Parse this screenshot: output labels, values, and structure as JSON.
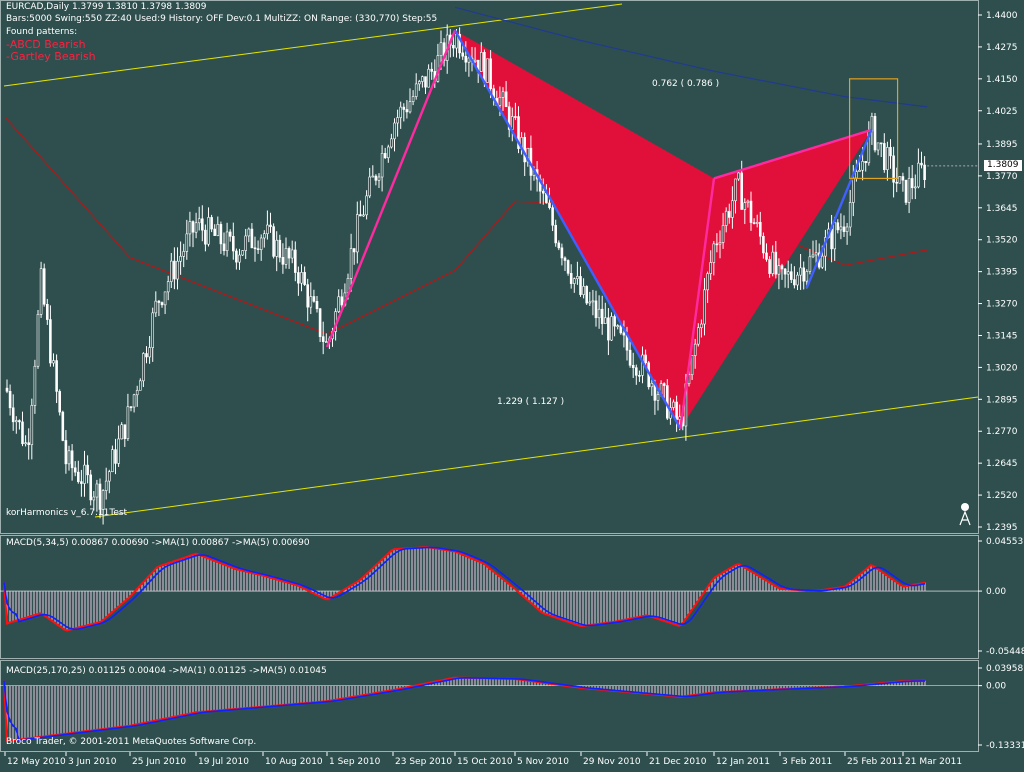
{
  "header": {
    "symbol_line": "EURCAD,Daily  1.3799 1.3810 1.3798 1.3809",
    "params_line": "Bars:5000  Swing:550  ZZ:40  Used:9  History: OFF Dev:0.1  MultiZZ: ON  Range: (330,770)  Step:55",
    "found_label": "Found patterns:",
    "patterns": [
      "-ABCD Bearish",
      "-Gartley Bearish"
    ]
  },
  "annotations": {
    "ratio_upper": "0.762 ( 0.786 )",
    "ratio_lower": "1.229 ( 1.127 )",
    "indicator_name": "korHarmonics  v_6.7.11Test",
    "current_price": "1.3809",
    "copyright": "Broco Trader, © 2001-2011 MetaQuotes Software Corp."
  },
  "colors": {
    "background": "#2f4f4f",
    "candles": "#ffffff",
    "pattern_fill": "#e0103a",
    "leg_pink": "#ff2aa0",
    "leg_blue": "#4060ff",
    "channel": "#e6e600",
    "ma_red": "#b01818",
    "ma_blue": "#203a90",
    "box": "#e0a020",
    "histogram": "#e8c8e0",
    "macd_red": "#ff1010",
    "macd_blue": "#1020ff"
  },
  "chart_data": [
    {
      "type": "candlestick",
      "title": "EURCAD,Daily",
      "ylim": [
        1.2395,
        1.44
      ],
      "y_ticks": [
        "1.4400",
        "1.4275",
        "1.4150",
        "1.4025",
        "1.3895",
        "1.3770",
        "1.3645",
        "1.3520",
        "1.3395",
        "1.3270",
        "1.3145",
        "1.3020",
        "1.2895",
        "1.2770",
        "1.2645",
        "1.2520",
        "1.2395"
      ],
      "x_ticks": [
        "12 May 2010",
        "3 Jun 2010",
        "25 Jun 2010",
        "19 Jul 2010",
        "10 Aug 2010",
        "1 Sep 2010",
        "23 Sep 2010",
        "15 Oct 2010",
        "5 Nov 2010",
        "29 Nov 2010",
        "21 Dec 2010",
        "12 Jan 2011",
        "3 Feb 2011",
        "25 Feb 2011",
        "21 Mar 2011"
      ],
      "close_path": [
        [
          "12 May 2010",
          1.295
        ],
        [
          "20 May 2010",
          1.27
        ],
        [
          "25 May 2010",
          1.335
        ],
        [
          "3 Jun 2010",
          1.265
        ],
        [
          "15 Jun 2010",
          1.252
        ],
        [
          "25 Jun 2010",
          1.285
        ],
        [
          "5 Jul 2010",
          1.328
        ],
        [
          "19 Jul 2010",
          1.358
        ],
        [
          "1 Aug 2010",
          1.348
        ],
        [
          "10 Aug 2010",
          1.355
        ],
        [
          "22 Aug 2010",
          1.34
        ],
        [
          "1 Sep 2010",
          1.31
        ],
        [
          "12 Sep 2010",
          1.36
        ],
        [
          "23 Sep 2010",
          1.398
        ],
        [
          "5 Oct 2010",
          1.415
        ],
        [
          "15 Oct 2010",
          1.432
        ],
        [
          "25 Oct 2010",
          1.42
        ],
        [
          "5 Nov 2010",
          1.395
        ],
        [
          "15 Nov 2010",
          1.368
        ],
        [
          "29 Nov 2010",
          1.33
        ],
        [
          "10 Dec 2010",
          1.315
        ],
        [
          "21 Dec 2010",
          1.3
        ],
        [
          "1 Jan 2011",
          1.279
        ],
        [
          "12 Jan 2011",
          1.35
        ],
        [
          "20 Jan 2011",
          1.373
        ],
        [
          "3 Feb 2011",
          1.335
        ],
        [
          "15 Feb 2011",
          1.345
        ],
        [
          "25 Feb 2011",
          1.36
        ],
        [
          "8 Mar 2011",
          1.395
        ],
        [
          "21 Mar 2011",
          1.37
        ],
        [
          "31 Mar 2011",
          1.3809
        ]
      ],
      "pattern_points": {
        "X": [
          "1 Sep 2010",
          1.31
        ],
        "A": [
          "15 Oct 2010",
          1.434
        ],
        "B": [
          "12 Jan 2011",
          1.376
        ],
        "C": [
          "1 Jan 2011",
          1.278
        ],
        "D": [
          "8 Mar 2011",
          1.395
        ]
      },
      "moving_averages": [
        {
          "name": "",
          "points": [
            [
              "12 May 2010",
              1.4
            ],
            [
              "25 Jun 2010",
              1.345
            ],
            [
              "1 Sep 2010",
              1.315
            ],
            [
              "15 Oct 2010",
              1.34
            ],
            [
              "5 Nov 2010",
              1.367
            ],
            [
              "12 Jan 2011",
              1.364
            ],
            [
              "25 Feb 2011",
              1.342
            ],
            [
              "31 Mar 2011",
              1.348
            ]
          ]
        },
        {
          "name": "",
          "points": [
            [
              "15 Oct 2010",
              1.443
            ],
            [
              "29 Nov 2010",
              1.43
            ],
            [
              "12 Jan 2011",
              1.418
            ],
            [
              "25 Feb 2011",
              1.408
            ],
            [
              "31 Mar 2011",
              1.404
            ]
          ]
        }
      ]
    },
    {
      "type": "bar",
      "title": "MACD(5,34,5) 0.00867 0.00690  ->MA(1) 0.00867  ->MA(5) 0.00690",
      "ylim": [
        -0.05448,
        0.04553
      ],
      "y_ticks": [
        "0.04553",
        "0.00",
        "-0.05448"
      ],
      "histogram": [
        [
          "12 May 2010",
          -0.03
        ],
        [
          "25 May 2010",
          -0.02
        ],
        [
          "3 Jun 2010",
          -0.036
        ],
        [
          "15 Jun 2010",
          -0.028
        ],
        [
          "25 Jun 2010",
          -0.005
        ],
        [
          "5 Jul 2010",
          0.022
        ],
        [
          "19 Jul 2010",
          0.034
        ],
        [
          "1 Aug 2010",
          0.02
        ],
        [
          "10 Aug 2010",
          0.014
        ],
        [
          "22 Aug 2010",
          0.005
        ],
        [
          "1 Sep 2010",
          -0.008
        ],
        [
          "12 Sep 2010",
          0.01
        ],
        [
          "23 Sep 2010",
          0.038
        ],
        [
          "5 Oct 2010",
          0.04
        ],
        [
          "15 Oct 2010",
          0.036
        ],
        [
          "25 Oct 2010",
          0.025
        ],
        [
          "5 Nov 2010",
          0.002
        ],
        [
          "15 Nov 2010",
          -0.02
        ],
        [
          "29 Nov 2010",
          -0.032
        ],
        [
          "10 Dec 2010",
          -0.028
        ],
        [
          "21 Dec 2010",
          -0.022
        ],
        [
          "1 Jan 2011",
          -0.032
        ],
        [
          "12 Jan 2011",
          0.012
        ],
        [
          "20 Jan 2011",
          0.025
        ],
        [
          "3 Feb 2011",
          0.002
        ],
        [
          "15 Feb 2011",
          0.0
        ],
        [
          "25 Feb 2011",
          0.004
        ],
        [
          "8 Mar 2011",
          0.024
        ],
        [
          "21 Mar 2011",
          0.004
        ],
        [
          "31 Mar 2011",
          0.008
        ]
      ]
    },
    {
      "type": "bar",
      "title": "MACD(25,170,25) 0.01125 0.00404  ->MA(1) 0.01125  ->MA(5) 0.01045",
      "ylim": [
        -0.13331,
        0.03958
      ],
      "y_ticks": [
        "0.03958",
        "0.00",
        "-0.13331"
      ],
      "histogram": [
        [
          "12 May 2010",
          -0.125
        ],
        [
          "25 Jun 2010",
          -0.09
        ],
        [
          "19 Jul 2010",
          -0.06
        ],
        [
          "1 Sep 2010",
          -0.035
        ],
        [
          "23 Sep 2010",
          -0.01
        ],
        [
          "15 Oct 2010",
          0.018
        ],
        [
          "5 Nov 2010",
          0.015
        ],
        [
          "29 Nov 2010",
          -0.005
        ],
        [
          "1 Jan 2011",
          -0.025
        ],
        [
          "12 Jan 2011",
          -0.015
        ],
        [
          "3 Feb 2011",
          -0.008
        ],
        [
          "25 Feb 2011",
          -0.002
        ],
        [
          "21 Mar 2011",
          0.01
        ],
        [
          "31 Mar 2011",
          0.011
        ]
      ]
    }
  ]
}
